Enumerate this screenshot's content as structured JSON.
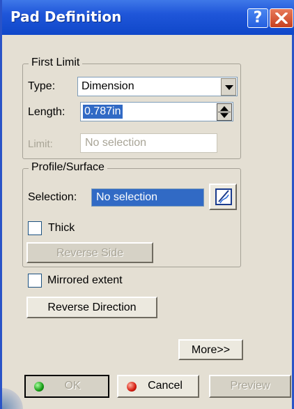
{
  "window": {
    "title": "Pad Definition",
    "help_label": "?"
  },
  "first_limit": {
    "group_label": "First Limit",
    "type_label": "Type:",
    "type_value": "Dimension",
    "length_label": "Length:",
    "length_value": "0.787in",
    "limit_label": "Limit:",
    "limit_value": "No selection"
  },
  "profile": {
    "group_label": "Profile/Surface",
    "selection_label": "Selection:",
    "selection_value": "No selection",
    "thick_label": "Thick",
    "thick_checked": false,
    "reverse_side_label": "Reverse Side"
  },
  "options": {
    "mirrored_label": "Mirrored extent",
    "mirrored_checked": false,
    "reverse_direction_label": "Reverse Direction",
    "more_label": "More>>"
  },
  "footer": {
    "ok_label": "OK",
    "cancel_label": "Cancel",
    "preview_label": "Preview"
  },
  "colors": {
    "titlebar": "#1f56d9",
    "dialog_bg": "#e4dfd3",
    "selection_bg": "#316ac5"
  }
}
